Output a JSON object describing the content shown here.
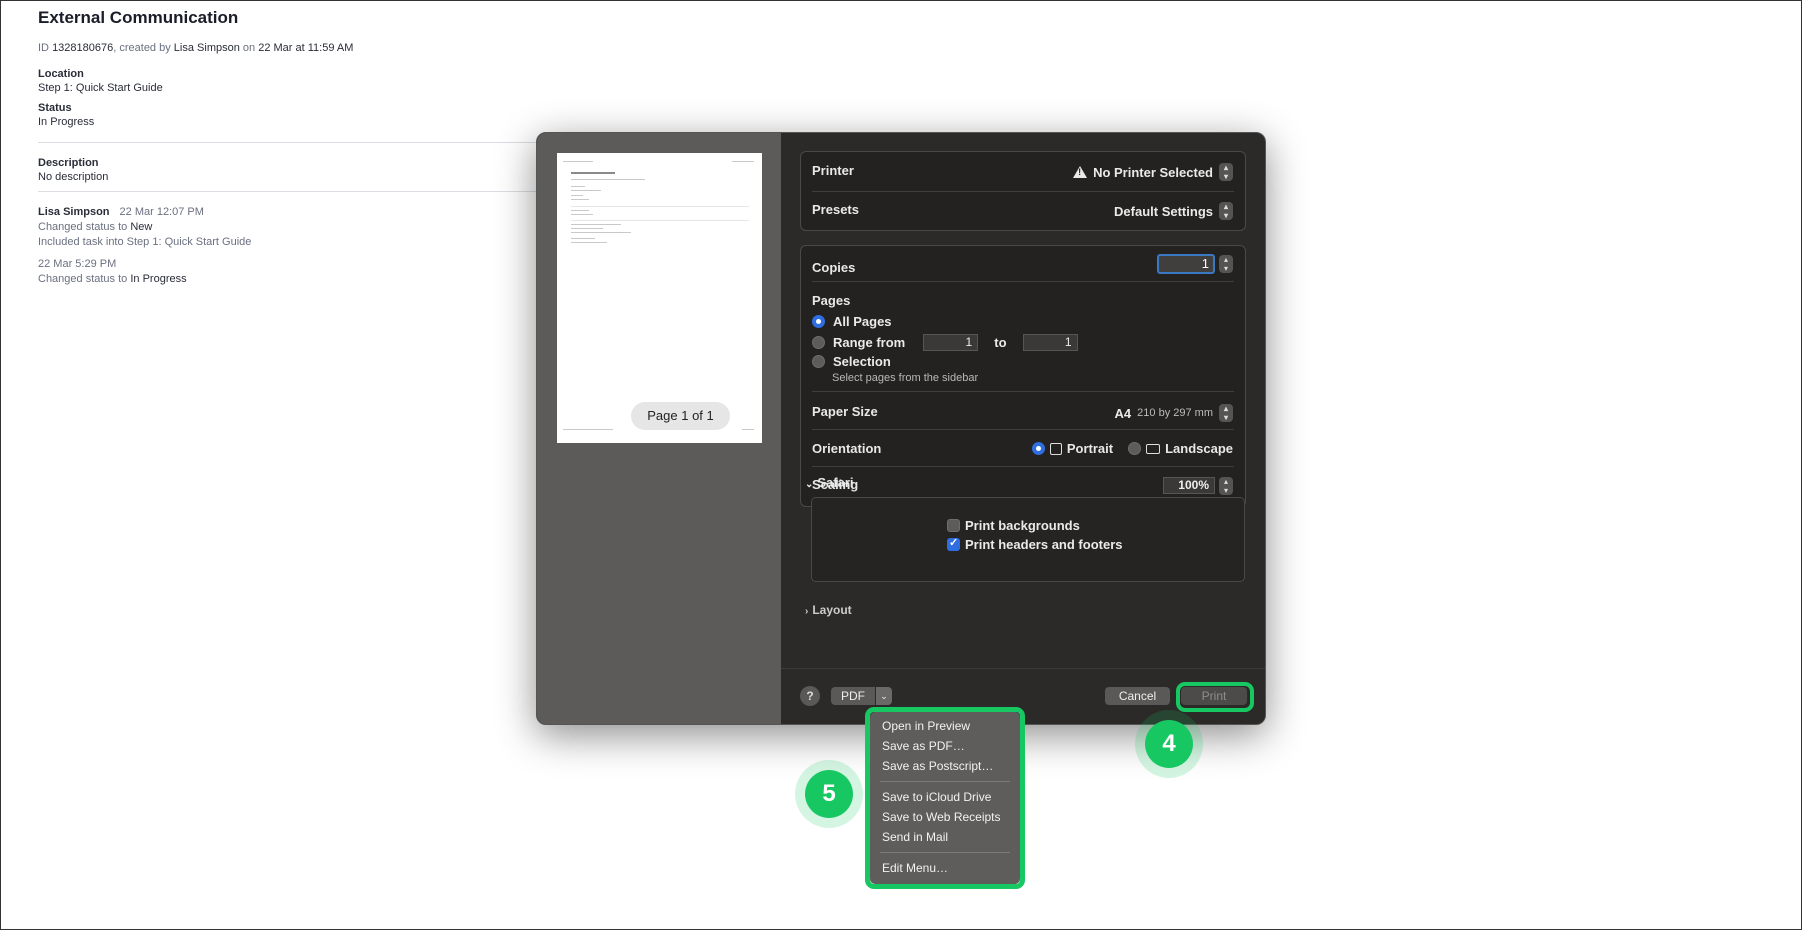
{
  "page": {
    "title": "External Communication",
    "meta": {
      "prefix": "ID",
      "id": "1328180676",
      "created_by_text": ", created by",
      "author": "Lisa Simpson",
      "on_text": "on",
      "date": "22 Mar at 11:59 AM"
    },
    "location_label": "Location",
    "location_value": "Step 1: Quick Start Guide",
    "status_label": "Status",
    "status_value": "In Progress",
    "description_label": "Description",
    "description_value": "No description",
    "activity": [
      {
        "who": "Lisa Simpson",
        "when": "22 Mar 12:07 PM",
        "line1_prefix": "Changed status to",
        "line1_value": "New",
        "line2": "Included task into Step 1: Quick Start Guide"
      },
      {
        "when": "22 Mar 5:29 PM",
        "line1_prefix": "Changed status to",
        "line1_value": "In Progress"
      }
    ]
  },
  "dialog": {
    "preview": {
      "page_indicator": "Page 1 of 1"
    },
    "printer": {
      "label": "Printer",
      "value": "No Printer Selected"
    },
    "presets": {
      "label": "Presets",
      "value": "Default Settings"
    },
    "copies": {
      "label": "Copies",
      "value": "1"
    },
    "pages": {
      "label": "Pages",
      "all_pages": "All Pages",
      "range_from": "Range from",
      "range_start": "1",
      "range_to": "to",
      "range_end": "1",
      "selection": "Selection",
      "selection_hint": "Select pages from the sidebar",
      "selected": "all_pages"
    },
    "paper_size": {
      "label": "Paper Size",
      "value": "A4",
      "dims": "210 by 297 mm"
    },
    "orientation": {
      "label": "Orientation",
      "portrait": "Portrait",
      "landscape": "Landscape",
      "selected": "portrait"
    },
    "scaling": {
      "label": "Scaling",
      "value": "100%"
    },
    "safari": {
      "label": "Safari",
      "print_backgrounds": "Print backgrounds",
      "print_backgrounds_checked": false,
      "print_headers": "Print headers and footers",
      "print_headers_checked": true
    },
    "layout": {
      "label": "Layout"
    },
    "footer": {
      "help": "?",
      "pdf": "PDF",
      "cancel": "Cancel",
      "print": "Print"
    }
  },
  "pdf_menu": {
    "items": [
      "Open in Preview",
      "Save as PDF…",
      "Save as Postscript…",
      "Save to iCloud Drive",
      "Save to Web Receipts",
      "Send in Mail",
      "Edit Menu…"
    ]
  },
  "badges": {
    "step4": "4",
    "step5": "5"
  },
  "colors": {
    "accent_green": "#17c862",
    "select_blue": "#2f6ee0",
    "dialog_bg": "#2b2a28"
  }
}
